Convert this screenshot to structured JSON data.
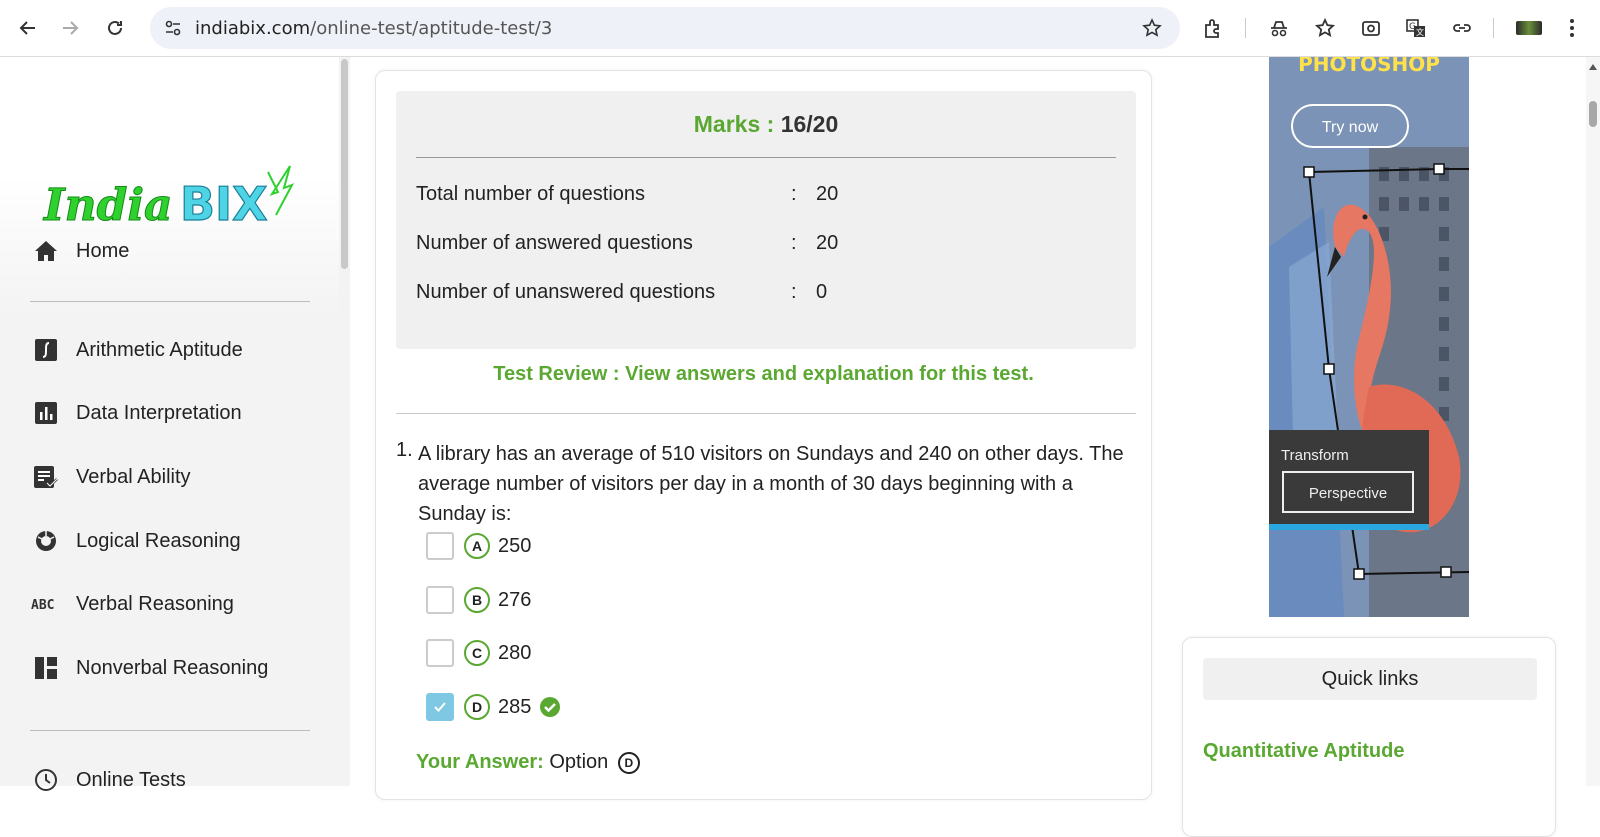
{
  "browser": {
    "url_domain": "indiabix.com",
    "url_path": "/online-test/aptitude-test/3"
  },
  "logo": {
    "text_left": "India",
    "text_right": "BIX"
  },
  "sidebar": {
    "items": [
      {
        "label": "Home",
        "icon": "home-icon"
      },
      {
        "label": "Arithmetic Aptitude",
        "icon": "integral-icon"
      },
      {
        "label": "Data Interpretation",
        "icon": "bar-chart-icon"
      },
      {
        "label": "Verbal Ability",
        "icon": "document-check-icon"
      },
      {
        "label": "Logical Reasoning",
        "icon": "ring-icon"
      },
      {
        "label": "Verbal Reasoning",
        "icon": "abc-icon"
      },
      {
        "label": "Nonverbal Reasoning",
        "icon": "dashboard-icon"
      },
      {
        "label": "Online Tests",
        "icon": "clock-icon"
      }
    ]
  },
  "summary": {
    "marks_label": "Marks :",
    "marks_value": "16/20",
    "rows": [
      {
        "label": "Total number of questions",
        "sep": ":",
        "value": "20"
      },
      {
        "label": "Number of answered questions",
        "sep": ":",
        "value": "20"
      },
      {
        "label": "Number of unanswered questions",
        "sep": ":",
        "value": "0"
      }
    ],
    "review_text": "Test Review : View answers and explanation for this test."
  },
  "question": {
    "number": "1.",
    "text": "A library has an average of 510 visitors on Sundays and 240 on other days. The average number of visitors per day in a month of 30 days beginning with a Sunday is:",
    "options": [
      {
        "letter": "A",
        "text": "250",
        "checked": false
      },
      {
        "letter": "B",
        "text": "276",
        "checked": false
      },
      {
        "letter": "C",
        "text": "280",
        "checked": false
      },
      {
        "letter": "D",
        "text": "285",
        "checked": true
      }
    ],
    "your_answer_label": "Your Answer:",
    "your_answer_value": "Option",
    "your_answer_letter": "D"
  },
  "ad": {
    "headline": "PHOTOSHOP",
    "cta": "Try now",
    "caption": "Transform",
    "button": "Perspective"
  },
  "quick_links": {
    "title": "Quick links",
    "first_link": "Quantitative Aptitude"
  },
  "colors": {
    "accent_green": "#5aa832",
    "check_blue": "#7ec8e3"
  }
}
